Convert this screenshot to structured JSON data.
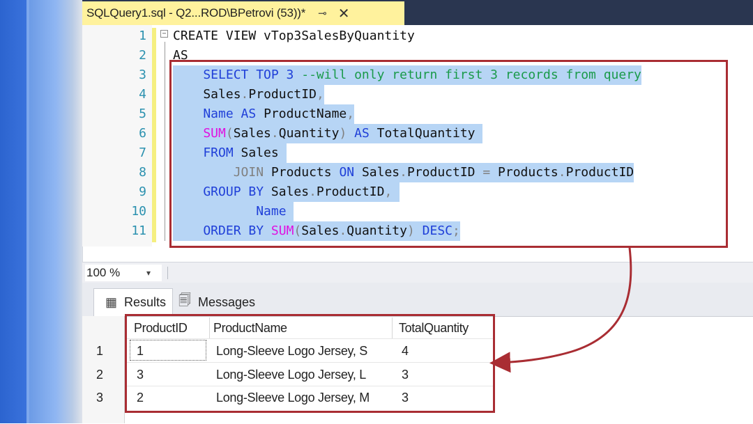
{
  "left_accent_colors": {
    "primary": "#2c64cf",
    "light": "#8fb6f2"
  },
  "tab": {
    "title": "SQLQuery1.sql - Q2...ROD\\BPetrovi (53))*",
    "pin_icon": "pin-icon",
    "close_glyph": "✕",
    "color": "#fff29d"
  },
  "editor": {
    "fold_glyph": "−",
    "line_numbers": [
      "1",
      "2",
      "3",
      "4",
      "5",
      "6",
      "7",
      "8",
      "9",
      "10",
      "11"
    ],
    "lines": [
      [
        {
          "t": "CREATE VIEW vTop3SalesByQuantity",
          "c": "tx"
        }
      ],
      [
        {
          "t": "AS",
          "c": "tx"
        }
      ],
      [
        {
          "t": "    SELECT TOP 3 ",
          "c": "kw"
        },
        {
          "t": "--will only return first 3 records from query",
          "c": "cm"
        }
      ],
      [
        {
          "t": "    Sales",
          "c": "tx"
        },
        {
          "t": ".",
          "c": "gr"
        },
        {
          "t": "ProductID",
          "c": "tx"
        },
        {
          "t": ",",
          "c": "gr"
        }
      ],
      [
        {
          "t": "    Name ",
          "c": "kw"
        },
        {
          "t": "AS ",
          "c": "kw"
        },
        {
          "t": "ProductName",
          "c": "tx"
        },
        {
          "t": ",",
          "c": "gr"
        }
      ],
      [
        {
          "t": "    SUM",
          "c": "fn"
        },
        {
          "t": "(",
          "c": "gr"
        },
        {
          "t": "Sales",
          "c": "tx"
        },
        {
          "t": ".",
          "c": "gr"
        },
        {
          "t": "Quantity",
          "c": "tx"
        },
        {
          "t": ") ",
          "c": "gr"
        },
        {
          "t": "AS ",
          "c": "kw"
        },
        {
          "t": "TotalQuantity ",
          "c": "tx"
        }
      ],
      [
        {
          "t": "    FROM ",
          "c": "kw"
        },
        {
          "t": "Sales ",
          "c": "tx"
        }
      ],
      [
        {
          "t": "        JOIN ",
          "c": "gr"
        },
        {
          "t": "Products ",
          "c": "tx"
        },
        {
          "t": "ON ",
          "c": "kw"
        },
        {
          "t": "Sales",
          "c": "tx"
        },
        {
          "t": ".",
          "c": "gr"
        },
        {
          "t": "ProductID ",
          "c": "tx"
        },
        {
          "t": "= ",
          "c": "gr"
        },
        {
          "t": "Products",
          "c": "tx"
        },
        {
          "t": ".",
          "c": "gr"
        },
        {
          "t": "ProductID",
          "c": "tx"
        }
      ],
      [
        {
          "t": "    GROUP BY ",
          "c": "kw"
        },
        {
          "t": "Sales",
          "c": "tx"
        },
        {
          "t": ".",
          "c": "gr"
        },
        {
          "t": "ProductID",
          "c": "tx"
        },
        {
          "t": ", ",
          "c": "gr"
        }
      ],
      [
        {
          "t": "           Name ",
          "c": "kw"
        }
      ],
      [
        {
          "t": "    ORDER BY ",
          "c": "kw"
        },
        {
          "t": "SUM",
          "c": "fn"
        },
        {
          "t": "(",
          "c": "gr"
        },
        {
          "t": "Sales",
          "c": "tx"
        },
        {
          "t": ".",
          "c": "gr"
        },
        {
          "t": "Quantity",
          "c": "tx"
        },
        {
          "t": ") ",
          "c": "gr"
        },
        {
          "t": "DESC",
          "c": "kw"
        },
        {
          "t": ";",
          "c": "gr"
        }
      ]
    ],
    "colors": {
      "keyword": "#1f3fd8",
      "function": "#e010e0",
      "comment": "#1a9a4a",
      "line_number": "#2b91af",
      "selection": "#b7d5f5"
    }
  },
  "zoom": {
    "value": "100 %",
    "dropdown_glyph": "▾"
  },
  "results_tabs": [
    {
      "label": "Results",
      "icon": "grid-icon",
      "active": true
    },
    {
      "label": "Messages",
      "icon": "messages-icon",
      "active": false
    }
  ],
  "results": {
    "columns": [
      "ProductID",
      "ProductName",
      "TotalQuantity"
    ],
    "rows": [
      {
        "num": "1",
        "cells": [
          "1",
          "Long-Sleeve Logo Jersey, S",
          "4"
        ]
      },
      {
        "num": "2",
        "cells": [
          "3",
          "Long-Sleeve Logo Jersey, L",
          "3"
        ]
      },
      {
        "num": "3",
        "cells": [
          "2",
          "Long-Sleeve Logo Jersey, M",
          "3"
        ]
      }
    ]
  },
  "annotation_color": "#a92d33"
}
